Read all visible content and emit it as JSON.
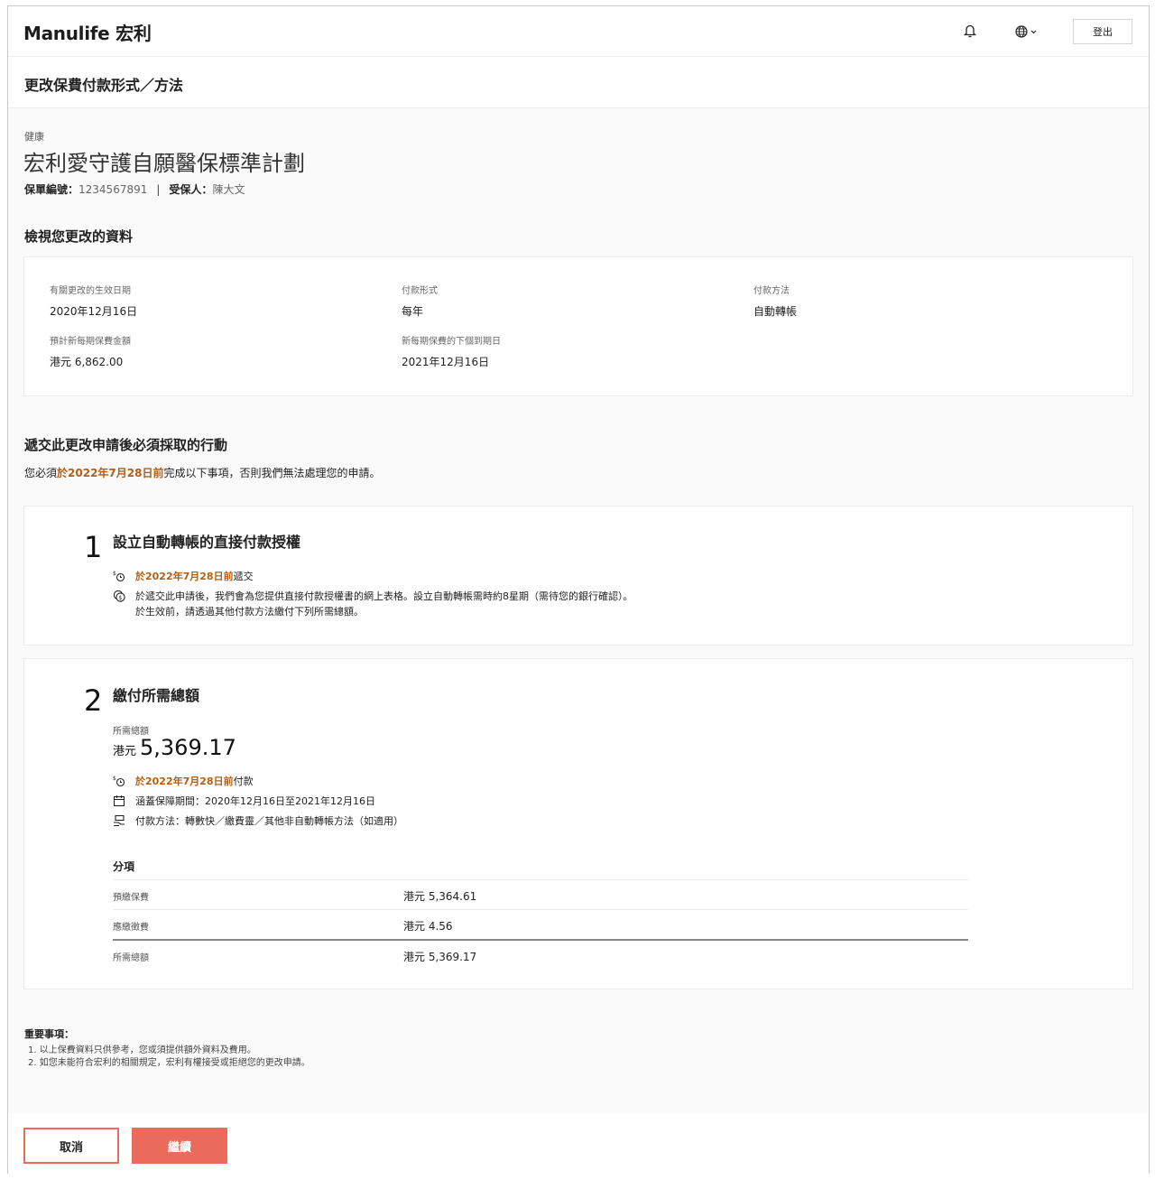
{
  "header": {
    "logo": "Manulife 宏利",
    "logout_label": "登出"
  },
  "page_title": "更改保費付款形式／方法",
  "policy": {
    "category": "健康",
    "name": "宏利愛守護自願醫保標準計劃",
    "number_label": "保單編號：",
    "number": "1234567891",
    "separator": "|",
    "insured_label": "受保人：",
    "insured": "陳大文"
  },
  "review": {
    "heading": "檢視您更改的資料",
    "fields": [
      {
        "label": "有關更改的生效日期",
        "value": "2020年12月16日"
      },
      {
        "label": "付款形式",
        "value": "每年"
      },
      {
        "label": "付款方法",
        "value": "自動轉帳"
      },
      {
        "label": "預計新每期保費金額",
        "value": "港元 6,862.00"
      },
      {
        "label": "新每期保費的下個到期日",
        "value": "2021年12月16日"
      }
    ]
  },
  "actions": {
    "heading": "遞交此更改申請後必須採取的行動",
    "intro_prefix": "您必須",
    "intro_deadline": "於2022年7月28日前",
    "intro_suffix": "完成以下事項，否則我們無法處理您的申請。"
  },
  "step1": {
    "number": "1",
    "title": "設立自動轉帳的直接付款授權",
    "deadline": "於2022年7月28日前",
    "deadline_suffix": "遞交",
    "info_line1": "於遞交此申請後，我們會為您提供直接付款授權書的網上表格。設立自動轉帳需時約8星期（需待您的銀行確認）。",
    "info_line2": "於生效前，請透過其他付款方法繳付下列所需總額。"
  },
  "step2": {
    "number": "2",
    "title": "繳付所需總額",
    "amount_label": "所需總額",
    "currency": "港元",
    "amount": "5,369.17",
    "deadline": "於2022年7月28日前",
    "deadline_suffix": "付款",
    "coverage": "涵蓋保障期間：2020年12月16日至2021年12月16日",
    "methods": "付款方法：轉數快／繳費靈／其他非自動轉帳方法（如適用）",
    "breakdown_heading": "分項",
    "breakdown": [
      {
        "label": "預繳保費",
        "value": "港元 5,364.61"
      },
      {
        "label": "應繳徵費",
        "value": "港元 4.56"
      }
    ],
    "total_label": "所需總額",
    "total_value": "港元 5,369.17"
  },
  "notes": {
    "heading": "重要事項：",
    "items": [
      "1. 以上保費資料只供參考，您或須提供額外資料及費用。",
      "2. 如您未能符合宏利的相關規定，宏利有權接受或拒絕您的更改申請。"
    ]
  },
  "footer": {
    "cancel_label": "取消",
    "continue_label": "繼續"
  },
  "colors": {
    "accent": "#ea6a5b",
    "deadline": "#b15f15"
  }
}
